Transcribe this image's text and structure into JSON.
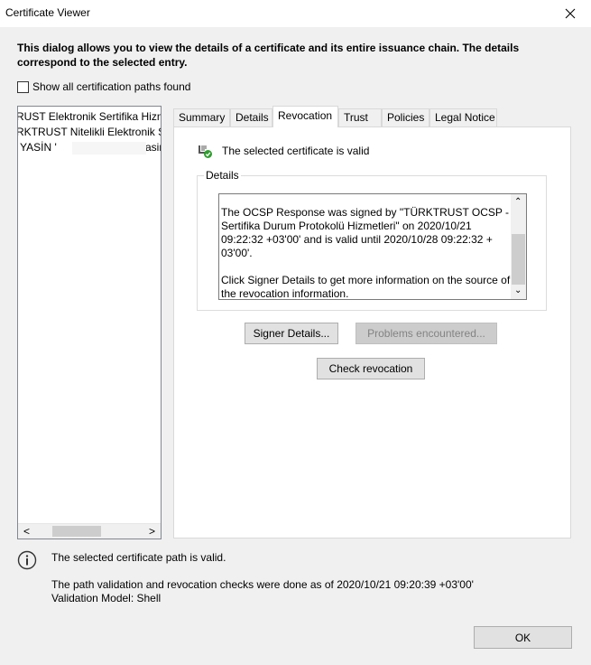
{
  "window": {
    "title": "Certificate Viewer",
    "close_icon": "close-icon"
  },
  "intro": "This dialog allows you to view the details of a certificate and its entire issuance chain. The details correspond to the selected entry.",
  "show_all": {
    "label": "Show all certification paths found",
    "checked": false
  },
  "chain": {
    "items": [
      {
        "label": "RUST Elektronik Sertifika Hizm"
      },
      {
        "label": "RKTRUST Nitelikli Elektronik Se"
      },
      {
        "label": "YASİN '"
      },
      {
        "label": "<yasir"
      }
    ]
  },
  "tabs": [
    {
      "label": "Summary"
    },
    {
      "label": "Details"
    },
    {
      "label": "Revocation",
      "active": true
    },
    {
      "label": "Trust"
    },
    {
      "label": "Policies"
    },
    {
      "label": "Legal Notice"
    }
  ],
  "revocation": {
    "status_icon": "valid-certificate-icon",
    "status_text": "The selected certificate is valid",
    "details_label": "Details",
    "details_paragraph_1": "The OCSP Response was signed by \"TÜRKTRUST OCSP - Sertifika Durum Protokolü Hizmetleri\" on 2020/10/21 09:22:32 +03'00' and is valid until 2020/10/28 09:22:32 + 03'00'.",
    "details_paragraph_2": "Click Signer Details to get more information on the source of the revocation information.",
    "signer_details_label": "Signer Details...",
    "problems_label": "Problems encountered...",
    "check_revocation_label": "Check revocation"
  },
  "footer": {
    "info_icon": "info-icon",
    "path_valid": "The selected certificate path is valid.",
    "checks_line_1": "The path validation and revocation checks were done as of 2020/10/21 09:20:39 +03'00'",
    "checks_line_2": "Validation Model: Shell",
    "ok_label": "OK"
  },
  "colors": {
    "valid_green": "#2e9e2e",
    "window_bg": "#f0f0f0"
  }
}
